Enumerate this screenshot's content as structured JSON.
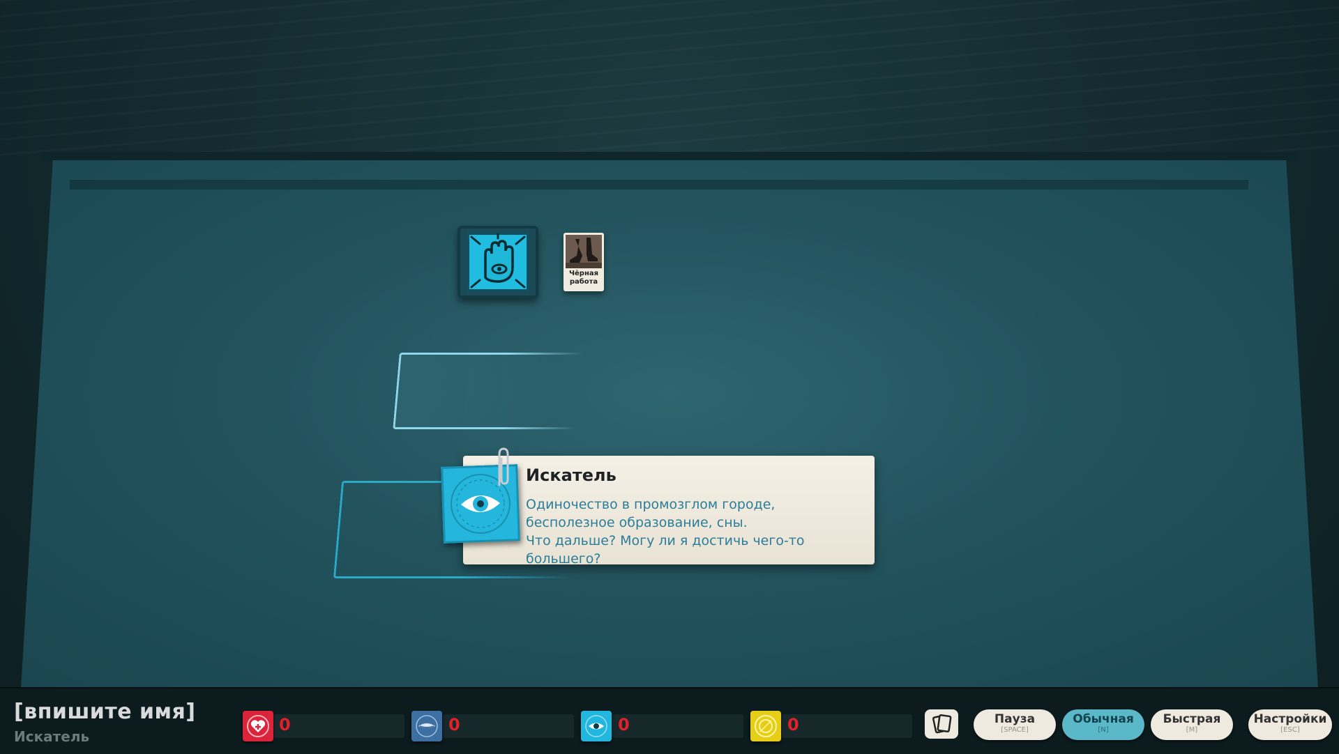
{
  "board": {
    "verb_token": {
      "icon": "raised-hand-eye-icon"
    },
    "card": {
      "label": "Чёрная работа",
      "icon": "boots-icon"
    }
  },
  "tooltip": {
    "title": "Искатель",
    "icon": "eye-icon",
    "description_line1": "Одиночество в промозглом городе, бесполезное образование, сны.",
    "description_line2": "Что дальше? Могу ли я достичь чего-то большего?"
  },
  "player": {
    "name": "[впишите имя]",
    "profession": "Искатель"
  },
  "resources": [
    {
      "icon": "heart-icon",
      "value": "0",
      "color": "#d9243a"
    },
    {
      "icon": "moon-icon",
      "value": "0",
      "color": "#3e6fa3"
    },
    {
      "icon": "eye-icon",
      "value": "0",
      "color": "#22b7de"
    },
    {
      "icon": "coin-icon",
      "value": "0",
      "color": "#e6cd18"
    }
  ],
  "controls": {
    "deck_icon": "cards-icon",
    "pause": {
      "label": "Пауза",
      "key": "[SPACE]"
    },
    "normal": {
      "label": "Обычная",
      "key": "[N]"
    },
    "fast": {
      "label": "Быстрая",
      "key": "[M]"
    },
    "settings": {
      "label": "Настройки",
      "key": "[ESC]"
    }
  }
}
